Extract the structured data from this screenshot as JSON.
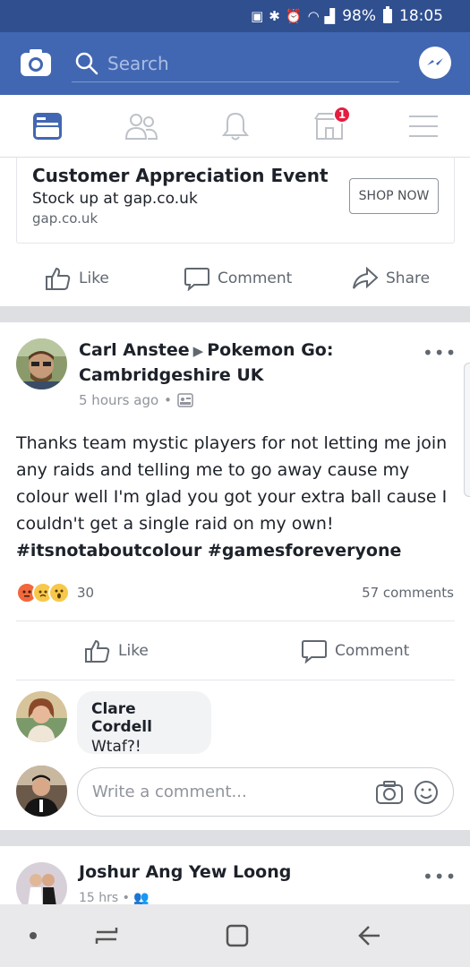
{
  "status_bar": {
    "battery": "98%",
    "time": "18:05"
  },
  "header": {
    "search_placeholder": "Search"
  },
  "tabs": [
    {
      "name": "news-feed",
      "active": true
    },
    {
      "name": "friends",
      "active": false
    },
    {
      "name": "notifications",
      "active": false
    },
    {
      "name": "marketplace",
      "active": false,
      "badge": "1"
    },
    {
      "name": "menu",
      "active": false
    }
  ],
  "ad": {
    "title": "Customer Appreciation Event",
    "subtitle": "Stock up at gap.co.uk",
    "domain": "gap.co.uk",
    "cta": "SHOP NOW"
  },
  "ad_actions": {
    "like": "Like",
    "comment": "Comment",
    "share": "Share"
  },
  "post": {
    "author": "Carl Anstee",
    "group": "Pokemon Go: Cambridgeshire UK",
    "time": "5 hours ago",
    "text": "Thanks team mystic players for not letting me join any raids and telling me to go away cause my colour well I'm glad you got your extra ball cause I couldn't get a single raid on my own!",
    "tags": "#itsnotaboutcolour #gamesforeveryone",
    "reaction_count": "30",
    "comments_count": "57 comments",
    "actions": {
      "like": "Like",
      "comment": "Comment"
    },
    "comment": {
      "author": "Clare Cordell",
      "text": "Wtaf?!"
    },
    "write_placeholder": "Write a comment..."
  },
  "next_post": {
    "author": "Joshur Ang Yew Loong",
    "time": "15 hrs"
  },
  "colors": {
    "brand": "#4267b2",
    "status_bar": "#2f4f8f",
    "active_tab": "#4267b2",
    "badge": "#e41e3f"
  }
}
